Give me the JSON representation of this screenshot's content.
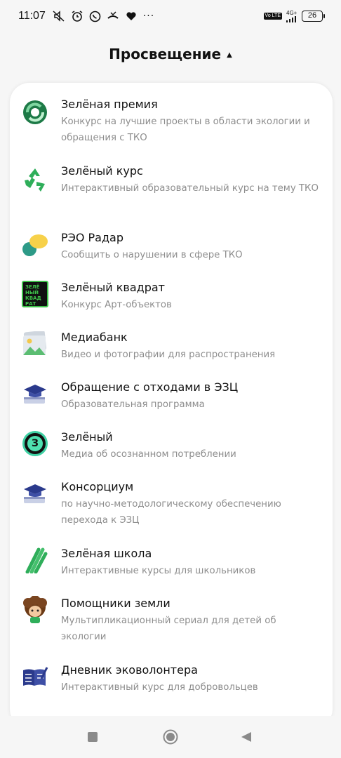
{
  "status": {
    "time": "11:07",
    "network": "4G+",
    "volte": "Vo LTE",
    "battery": "26",
    "more": "···"
  },
  "header": {
    "title": "Просвещение",
    "caret": "▲"
  },
  "items": [
    {
      "title": "Зелёная премия",
      "sub": "Конкурс на лучшие проекты в области экологии и обращения с ТКО",
      "icon": "eco-award-icon"
    },
    {
      "title": "Зелёный курс",
      "sub": "Интерактивный образовательный курс на тему ТКО",
      "icon": "recycle-icon"
    },
    {
      "title": "РЭО Радар",
      "sub": "Сообщить о нарушении в сфере ТКО",
      "icon": "radar-bubbles-icon"
    },
    {
      "title": "Зелёный квадрат",
      "sub": "Конкурс Арт-объектов",
      "icon": "green-square-icon",
      "icon_text": "ЗЕЛЁ НЫЙ КВАД РАТ"
    },
    {
      "title": "Медиабанк",
      "sub": "Видео и фотографии для распространения",
      "icon": "image-icon"
    },
    {
      "title": "Обращение с отходами в ЭЗЦ",
      "sub": "Образовательная программа",
      "icon": "graduation-cap-icon"
    },
    {
      "title": "Зелёный",
      "sub": "Медиа об осознанном потреблении",
      "icon": "z-circle-icon",
      "icon_text": "З"
    },
    {
      "title": "Консорциум",
      "sub": "по научно-методологическому обеспечению перехода к ЭЗЦ",
      "icon": "graduation-cap-icon"
    },
    {
      "title": "Зелёная школа",
      "sub": "Интерактивные курсы для школьников",
      "icon": "pencils-icon"
    },
    {
      "title": "Помощники земли",
      "sub": "Мультипликационный сериал для детей об экологии",
      "icon": "cartoon-character-icon"
    },
    {
      "title": "Дневник эковолонтера",
      "sub": "Интерактивный курс для добровольцев",
      "icon": "diary-icon"
    }
  ],
  "colors": {
    "accent_green": "#2fae5a",
    "dark_green": "#1d7a47",
    "subtitle_gray": "#8d8d8d",
    "navy": "#2b3a8c"
  }
}
